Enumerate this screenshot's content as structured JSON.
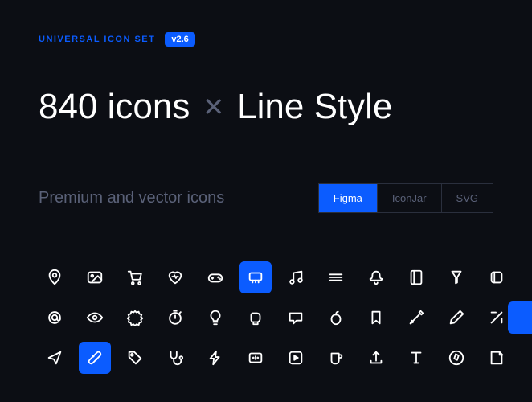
{
  "brand": {
    "label": "UNIVERSAL ICON SET",
    "version": "v2.6"
  },
  "title": {
    "count": "840 icons",
    "separator": "✕",
    "style": "Line Style"
  },
  "subtitle": "Premium and vector icons",
  "tabs": [
    {
      "label": "Figma",
      "active": true
    },
    {
      "label": "IconJar",
      "active": false
    },
    {
      "label": "SVG",
      "active": false
    }
  ],
  "icons": [
    {
      "name": "pin",
      "row": 0,
      "col": 0
    },
    {
      "name": "image",
      "row": 0,
      "col": 1
    },
    {
      "name": "cart",
      "row": 0,
      "col": 2
    },
    {
      "name": "heart-pulse",
      "row": 0,
      "col": 3
    },
    {
      "name": "gamepad",
      "row": 0,
      "col": 4
    },
    {
      "name": "connector",
      "row": 0,
      "col": 5,
      "highlighted": true
    },
    {
      "name": "music",
      "row": 0,
      "col": 6
    },
    {
      "name": "burger",
      "row": 0,
      "col": 7
    },
    {
      "name": "bell",
      "row": 0,
      "col": 8
    },
    {
      "name": "book",
      "row": 0,
      "col": 9
    },
    {
      "name": "filter",
      "row": 0,
      "col": 10
    },
    {
      "name": "layers",
      "row": 0,
      "col": 11
    },
    {
      "name": "at-sign",
      "row": 1,
      "col": 0
    },
    {
      "name": "eye",
      "row": 1,
      "col": 1
    },
    {
      "name": "badge",
      "row": 1,
      "col": 2
    },
    {
      "name": "stopwatch",
      "row": 1,
      "col": 3
    },
    {
      "name": "bulb",
      "row": 1,
      "col": 4
    },
    {
      "name": "boxing",
      "row": 1,
      "col": 5
    },
    {
      "name": "message",
      "row": 1,
      "col": 6
    },
    {
      "name": "apple",
      "row": 1,
      "col": 7
    },
    {
      "name": "bookmark",
      "row": 1,
      "col": 8
    },
    {
      "name": "dropper",
      "row": 1,
      "col": 9
    },
    {
      "name": "pen",
      "row": 1,
      "col": 10
    },
    {
      "name": "edge",
      "row": 1,
      "col": 11
    },
    {
      "name": "send",
      "row": 2,
      "col": 0
    },
    {
      "name": "bandage",
      "row": 2,
      "col": 1,
      "highlighted": true
    },
    {
      "name": "tag",
      "row": 2,
      "col": 2
    },
    {
      "name": "stethoscope",
      "row": 2,
      "col": 3
    },
    {
      "name": "bolt",
      "row": 2,
      "col": 4
    },
    {
      "name": "ratio",
      "row": 2,
      "col": 5
    },
    {
      "name": "play",
      "row": 2,
      "col": 6
    },
    {
      "name": "cup",
      "row": 2,
      "col": 7
    },
    {
      "name": "upload",
      "row": 2,
      "col": 8
    },
    {
      "name": "text",
      "row": 2,
      "col": 9
    },
    {
      "name": "compass",
      "row": 2,
      "col": 10
    },
    {
      "name": "note",
      "row": 2,
      "col": 11
    }
  ]
}
